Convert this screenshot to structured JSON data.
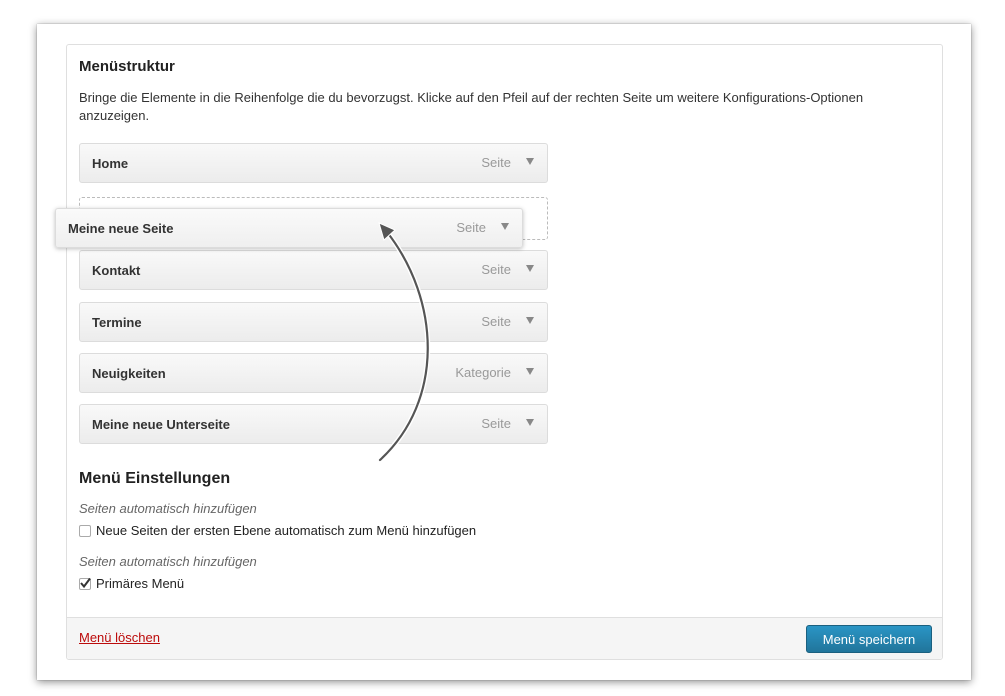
{
  "menu_structure": {
    "heading": "Menüstruktur",
    "intro": "Bringe die Elemente in die Reihenfolge die du bevorzugst. Klicke auf den Pfeil auf der rechten Seite um weitere Konfigurations-Optionen anzuzeigen.",
    "items": [
      {
        "title": "Home",
        "type": "Seite"
      },
      {
        "title": "Meine neue Seite",
        "type": "Seite",
        "state": "dragging"
      },
      {
        "title": "Kontakt",
        "type": "Seite"
      },
      {
        "title": "Termine",
        "type": "Seite"
      },
      {
        "title": "Neuigkeiten",
        "type": "Kategorie"
      },
      {
        "title": "Meine neue Unterseite",
        "type": "Seite"
      }
    ],
    "expand_icon": "triangle-down-icon"
  },
  "menu_settings": {
    "heading": "Menü Einstellungen",
    "auto_add_label": "Seiten automatisch hinzufügen",
    "auto_add_option": {
      "label": "Neue Seiten der ersten Ebene automatisch zum Menü hinzufügen",
      "checked": false
    },
    "location_label": "Seiten automatisch hinzufügen",
    "location_option": {
      "label": "Primäres Menü",
      "checked": true
    }
  },
  "footer": {
    "delete_label": "Menü löschen",
    "save_label": "Menü speichern"
  },
  "colors": {
    "primary_button": "#21759b",
    "delete_link": "#bc0b0b",
    "item_background": "#f1f1f1"
  }
}
